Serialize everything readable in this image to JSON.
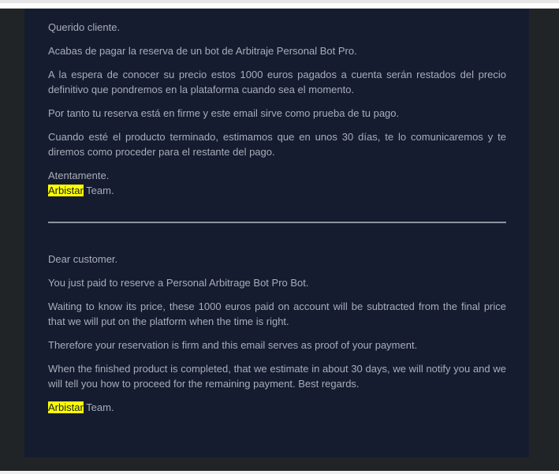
{
  "email": {
    "spanish": {
      "greeting": "Querido cliente.",
      "p1": "Acabas de pagar la reserva de un bot de Arbitraje Personal Bot Pro.",
      "p2": "A la espera de conocer su precio estos 1000 euros pagados a cuenta serán restados del precio definitivo que pondremos en la plataforma cuando sea el momento.",
      "p3": "Por tanto tu reserva está en firme y este email sirve como prueba de tu pago.",
      "p4": "Cuando esté el producto terminado, estimamos que en unos 30 días, te lo comunicaremos y te diremos como proceder para el restante del pago.",
      "closing": "Atentamente.",
      "brand": "Arbistar",
      "team": " Team."
    },
    "english": {
      "greeting": "Dear customer.",
      "p1": "You just paid to reserve a Personal Arbitrage Bot Pro Bot.",
      "p2": "Waiting to know its price, these 1000 euros paid on account will be subtracted from the final price that we will put on the platform when the time is right.",
      "p3": "Therefore your reservation is firm and this email serves as proof of your payment.",
      "p4": "When the finished product is completed, that we estimate in about 30 days, we will notify you and we will tell you how to proceed for the remaining payment. Best regards.",
      "brand": "Arbistar",
      "team": " Team."
    }
  },
  "colors": {
    "page_background": "#212427",
    "panel_background": "#151c30",
    "text": "#a7adb8",
    "highlight": "#ffff00",
    "divider": "#8e94a0"
  }
}
